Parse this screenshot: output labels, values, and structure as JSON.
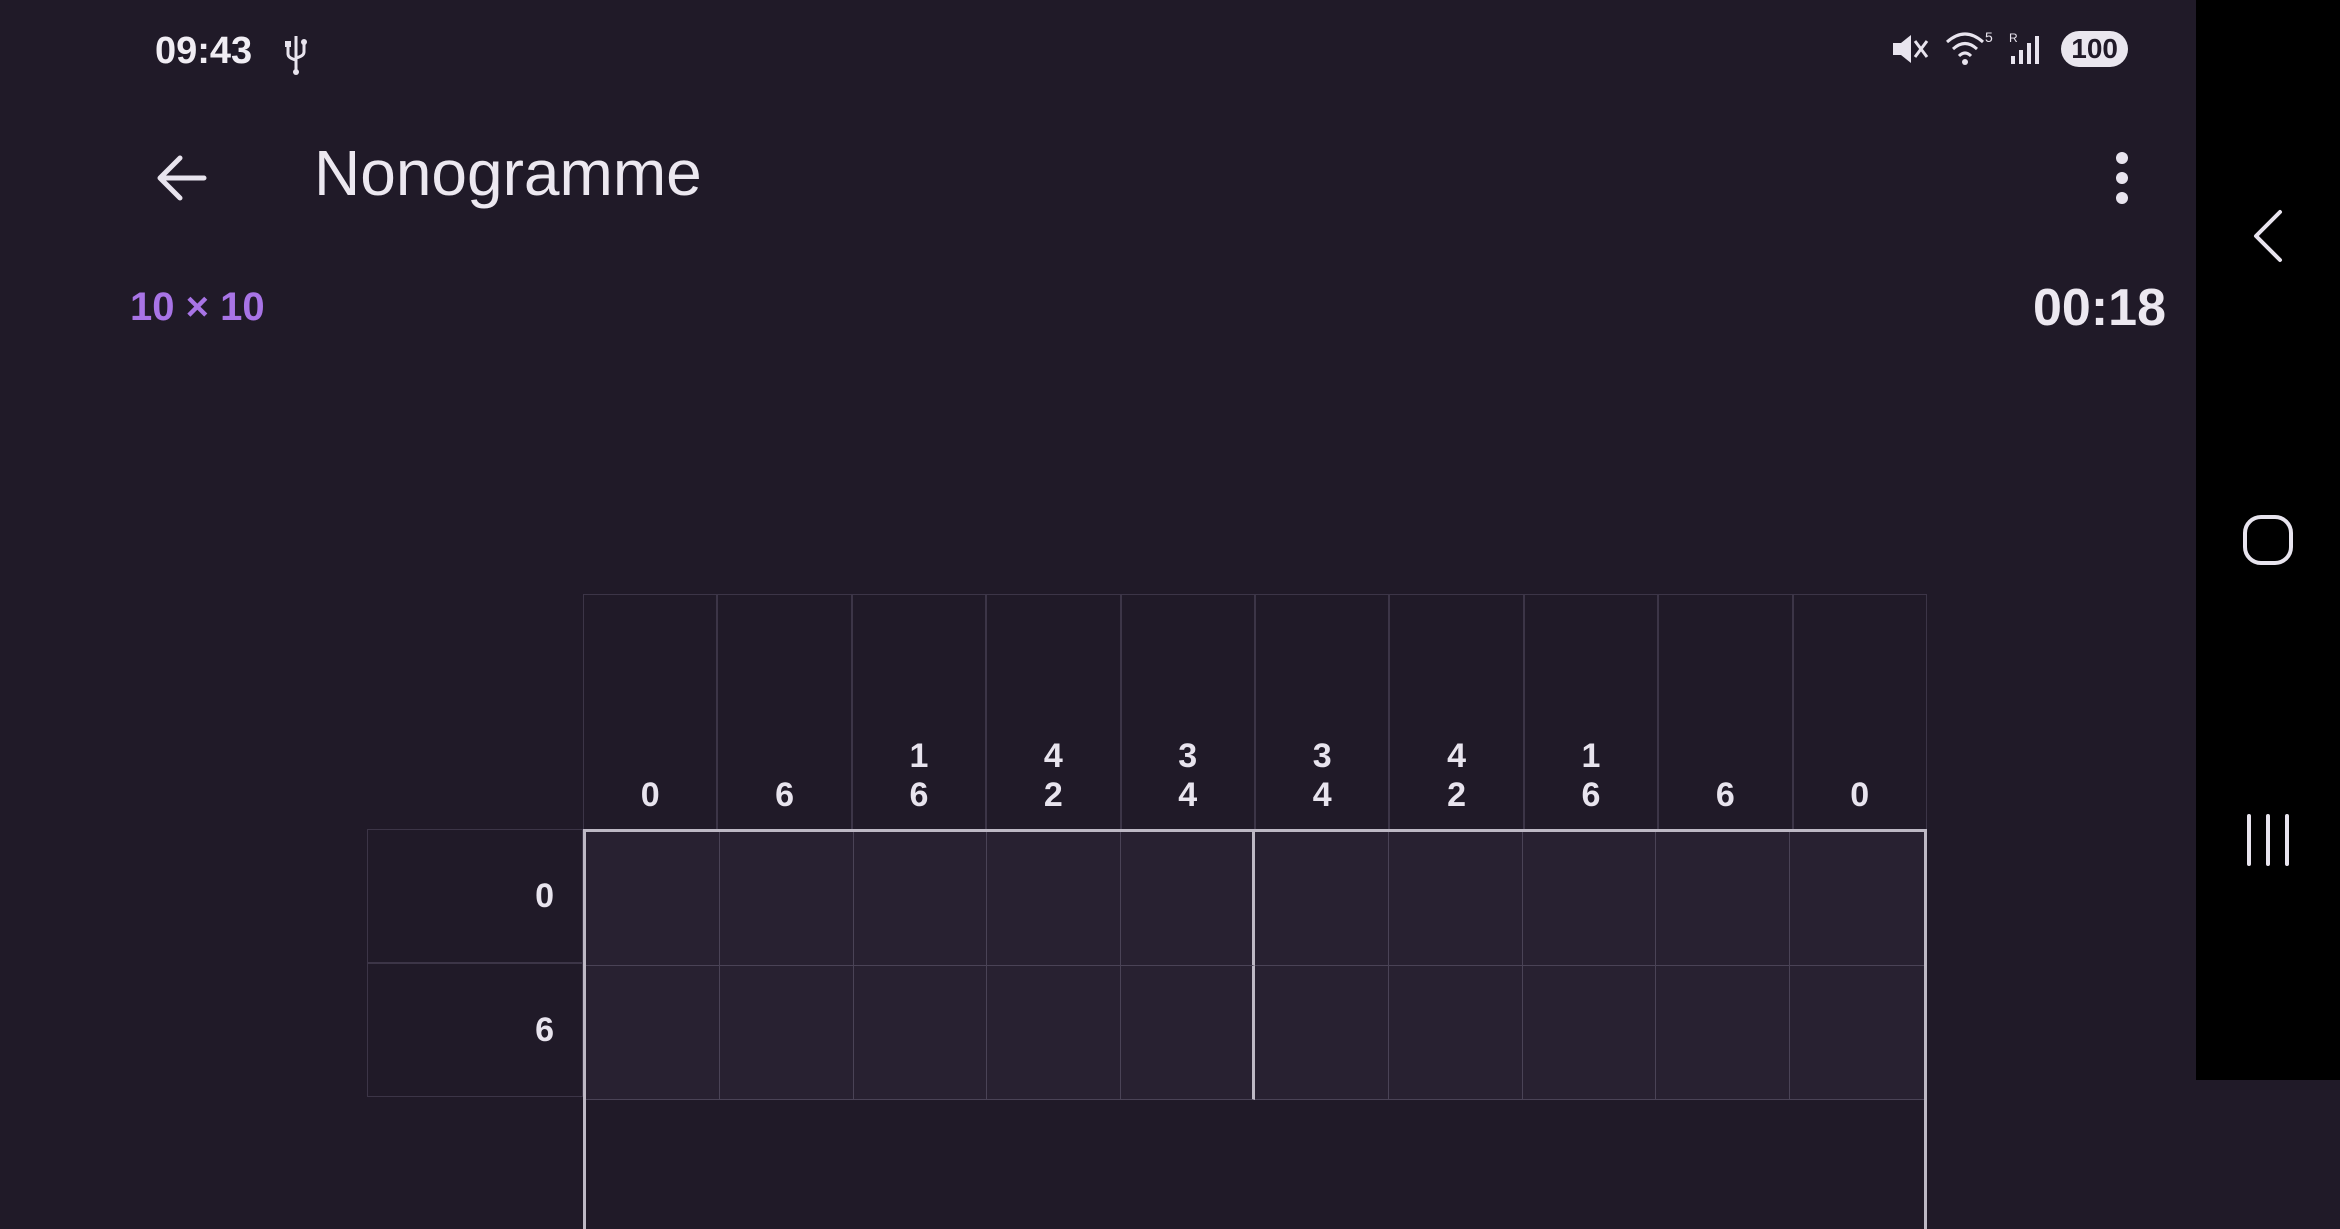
{
  "status_bar": {
    "time": "09:43",
    "icons": [
      "usb-icon",
      "mute-icon",
      "wifi-icon",
      "signal-icon"
    ],
    "wifi_label": "5",
    "signal_label": "R",
    "battery": "100"
  },
  "app_bar": {
    "title": "Nonogramme",
    "back_icon": "arrow-back-icon",
    "menu_icon": "more-vert-icon"
  },
  "puzzle": {
    "size_label": "10 × 10",
    "timer": "00:18",
    "column_clues": [
      [
        "0"
      ],
      [
        "6"
      ],
      [
        "1",
        "6"
      ],
      [
        "4",
        "2"
      ],
      [
        "3",
        "4"
      ],
      [
        "3",
        "4"
      ],
      [
        "4",
        "2"
      ],
      [
        "1",
        "6"
      ],
      [
        "6"
      ],
      [
        "0"
      ]
    ],
    "row_clues": [
      "0",
      "6"
    ]
  },
  "nav_bar": {
    "icons": [
      "nav-back-icon",
      "nav-home-icon",
      "nav-recents-icon"
    ]
  },
  "colors": {
    "background": "#201a28",
    "accent": "#a874e6",
    "cell": "#282131",
    "grid_line": "#4a4356",
    "thick_line": "#bdb8c4"
  }
}
